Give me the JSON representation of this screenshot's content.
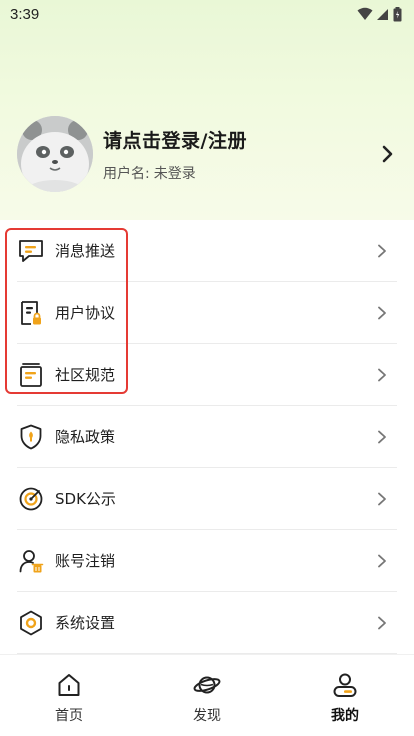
{
  "status_bar": {
    "time": "3:39",
    "icons": [
      "wifi-icon",
      "signal-icon",
      "battery-icon"
    ]
  },
  "profile": {
    "title": "请点击登录/注册",
    "username_label": "用户名:",
    "username_value": "未登录",
    "avatar_icon": "panda-avatar"
  },
  "menu": {
    "items": [
      {
        "label": "消息推送",
        "icon": "message-icon"
      },
      {
        "label": "用户协议",
        "icon": "document-lock-icon"
      },
      {
        "label": "社区规范",
        "icon": "card-list-icon"
      },
      {
        "label": "隐私政策",
        "icon": "shield-icon"
      },
      {
        "label": "SDK公示",
        "icon": "target-icon"
      },
      {
        "label": "账号注销",
        "icon": "user-delete-icon"
      },
      {
        "label": "系统设置",
        "icon": "hexagon-settings-icon"
      }
    ]
  },
  "tabbar": {
    "tabs": [
      {
        "label": "首页",
        "icon": "home-icon"
      },
      {
        "label": "发现",
        "icon": "planet-icon"
      },
      {
        "label": "我的",
        "icon": "profile-icon"
      }
    ],
    "active": "我的"
  },
  "colors": {
    "accent": "#f0a31a",
    "highlight": "#e53a34",
    "header_bg": "#eef8db"
  }
}
